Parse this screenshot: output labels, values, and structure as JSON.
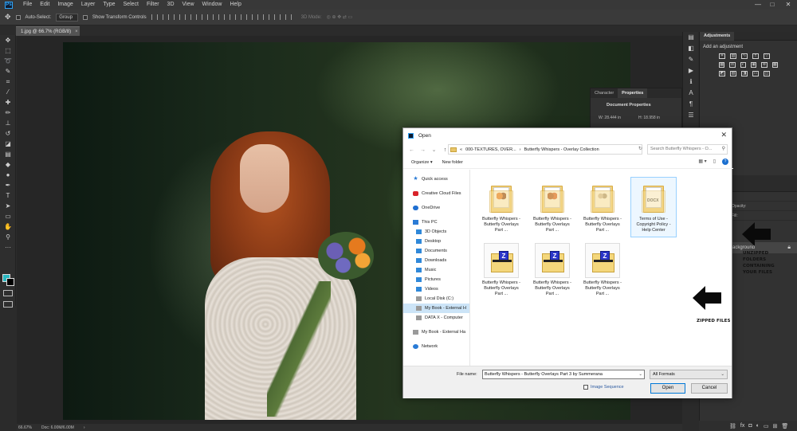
{
  "app": {
    "menu": [
      "File",
      "Edit",
      "Image",
      "Layer",
      "Type",
      "Select",
      "Filter",
      "3D",
      "View",
      "Window",
      "Help"
    ],
    "window_controls": {
      "minimize": "—",
      "maximize": "□",
      "close": "✕"
    }
  },
  "options_bar": {
    "auto_select_label": "Auto-Select:",
    "auto_select_value": "Group",
    "show_transform_label": "Show Transform Controls",
    "mode_3d_label": "3D Mode:"
  },
  "document": {
    "tab_title": "1.jpg @ 66.7% (RGB/8)",
    "tab_close": "×",
    "zoom": "66.67%",
    "doc_size": "Doc: 6.00M/6.00M"
  },
  "panels": {
    "adjustments_tab": "Adjustments",
    "adjustments_heading": "Add an adjustment",
    "properties_tabs": [
      "Character",
      "Properties"
    ],
    "document_properties": "Document Properties",
    "width_value": "W: 28.444 in",
    "height_value": "H: 18.958 in",
    "layers_background": "Background",
    "layers_opacity": "Opacity:",
    "layers_fill": "Fill:"
  },
  "dialog": {
    "title": "Open",
    "close": "✕",
    "address": {
      "prefix": "«",
      "segment1": "000-TEXTURES, OVER...",
      "separator": "›",
      "segment2": "Butterfly Whispers - Overlay Collection"
    },
    "search_placeholder": "Search Butterfly Whispers - O...",
    "toolbar": {
      "organize": "Organize ▾",
      "new_folder": "New folder",
      "help": "?"
    },
    "nav": [
      {
        "label": "Quick access",
        "icon": "star"
      },
      {
        "label": "Creative Cloud Files",
        "icon": "cloud"
      },
      {
        "label": "OneDrive",
        "icon": "onedrive"
      },
      {
        "label": "This PC",
        "icon": "pc"
      },
      {
        "label": "3D Objects",
        "icon": "blue"
      },
      {
        "label": "Desktop",
        "icon": "blue"
      },
      {
        "label": "Documents",
        "icon": "blue"
      },
      {
        "label": "Downloads",
        "icon": "blue"
      },
      {
        "label": "Music",
        "icon": "blue"
      },
      {
        "label": "Pictures",
        "icon": "blue"
      },
      {
        "label": "Videos",
        "icon": "blue"
      },
      {
        "label": "Local Disk (C:)",
        "icon": "drive"
      },
      {
        "label": "My Book - External H",
        "icon": "drive"
      },
      {
        "label": "DATA X - Computer",
        "icon": "drive"
      },
      {
        "label": "My Book - External Ha",
        "icon": "drive"
      },
      {
        "label": "Network",
        "icon": "net"
      }
    ],
    "files": [
      {
        "label": "Butterfly Whispers - Butterfly Overlays Part ...",
        "kind": "folder",
        "thumb": "butterfly"
      },
      {
        "label": "Butterfly Whispers - Butterfly Overlays Part ...",
        "kind": "folder",
        "thumb": "butterfly-dark"
      },
      {
        "label": "Butterfly Whispers - Butterfly Overlays Part ...",
        "kind": "folder",
        "thumb": "butterfly-light"
      },
      {
        "label": "Terms of Use - Copyright Policy - Help Center",
        "kind": "folder",
        "thumb": "docx",
        "doc_text": "DOCX"
      },
      {
        "label": "Butterfly Whispers - Butterfly Overlays Part ...",
        "kind": "zip"
      },
      {
        "label": "Butterfly Whispers - Butterfly Overlays Part ...",
        "kind": "zip"
      },
      {
        "label": "Butterfly Whispers - Butterfly Overlays Part ...",
        "kind": "zip"
      }
    ],
    "annotations": {
      "unzipped": "UNZIPPED FOLDERS CONTAINING YOUR FILES",
      "zipped": "ZIPPED FILES"
    },
    "filename_label": "File name:",
    "filename_value": "Butterfly Whispers - Butterfly Overlays Part 3 by Summerana",
    "filter_value": "All Formats",
    "image_sequence_label": "Image Sequence",
    "open_label": "Open",
    "cancel_label": "Cancel"
  },
  "colors": {
    "foreground": "#2ab7c0",
    "background": "#000000",
    "selection": "#cce4f7"
  }
}
